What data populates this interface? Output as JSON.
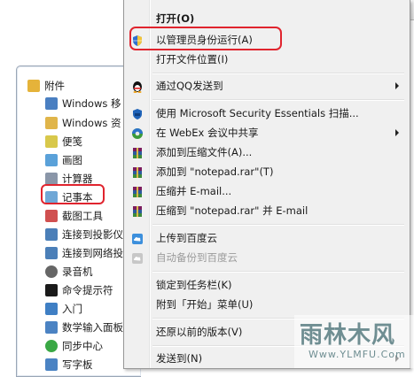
{
  "start_menu": {
    "items": [
      {
        "label": "附件",
        "icon": "folder-icon",
        "color": "#e5b33a"
      },
      {
        "label": "Windows 移",
        "icon": "windows-mobility-icon",
        "color": "#4a7fc1"
      },
      {
        "label": "Windows 资",
        "icon": "explorer-folder-icon",
        "color": "#e0b54a"
      },
      {
        "label": "便笺",
        "icon": "sticky-note-icon",
        "color": "#d8c84b"
      },
      {
        "label": "画图",
        "icon": "paint-icon",
        "color": "#5aa1d9"
      },
      {
        "label": "计算器",
        "icon": "calculator-icon",
        "color": "#8a96a8"
      },
      {
        "label": "记事本",
        "icon": "notepad-icon",
        "color": "#6fa7d6"
      },
      {
        "label": "截图工具",
        "icon": "snipping-tool-icon",
        "color": "#d05050"
      },
      {
        "label": "连接到投影仪",
        "icon": "projector-icon",
        "color": "#4b7fb8"
      },
      {
        "label": "连接到网络投",
        "icon": "network-projector-icon",
        "color": "#4b7fb8"
      },
      {
        "label": "录音机",
        "icon": "microphone-icon",
        "color": "#666666"
      },
      {
        "label": "命令提示符",
        "icon": "command-prompt-icon",
        "color": "#1a1a1a"
      },
      {
        "label": "入门",
        "icon": "getting-started-icon",
        "color": "#3f7fc4"
      },
      {
        "label": "数学输入面板",
        "icon": "math-input-icon",
        "color": "#4b83c3"
      },
      {
        "label": "同步中心",
        "icon": "sync-center-icon",
        "color": "#3aa845"
      },
      {
        "label": "写字板",
        "icon": "wordpad-icon",
        "color": "#4b83c3"
      }
    ]
  },
  "context_menu": {
    "items": [
      {
        "label": "打开(O)",
        "bold": true,
        "icon": "",
        "disabled": false,
        "submenu": false
      },
      {
        "label": "以管理员身份运行(A)",
        "icon": "uac-shield-icon",
        "disabled": false,
        "submenu": false
      },
      {
        "label": "打开文件位置(I)",
        "icon": "",
        "disabled": false,
        "submenu": false
      },
      {
        "label": "通过QQ发送到",
        "icon": "qq-penguin-icon",
        "disabled": false,
        "submenu": true
      },
      {
        "label": "使用 Microsoft Security Essentials 扫描...",
        "icon": "mse-shield-icon",
        "disabled": false,
        "submenu": false
      },
      {
        "label": "在 WebEx 会议中共享",
        "icon": "webex-icon",
        "disabled": false,
        "submenu": true
      },
      {
        "label": "添加到压缩文件(A)...",
        "icon": "winrar-icon",
        "disabled": false,
        "submenu": false
      },
      {
        "label": "添加到 \"notepad.rar\"(T)",
        "icon": "winrar-icon",
        "disabled": false,
        "submenu": false
      },
      {
        "label": "压缩并 E-mail...",
        "icon": "winrar-icon",
        "disabled": false,
        "submenu": false
      },
      {
        "label": "压缩到 \"notepad.rar\" 并 E-mail",
        "icon": "winrar-icon",
        "disabled": false,
        "submenu": false
      },
      {
        "label": "上传到百度云",
        "icon": "baidu-cloud-icon",
        "disabled": false,
        "submenu": false
      },
      {
        "label": "自动备份到百度云",
        "icon": "baidu-cloud-icon",
        "disabled": true,
        "submenu": false
      },
      {
        "label": "锁定到任务栏(K)",
        "icon": "",
        "disabled": false,
        "submenu": false
      },
      {
        "label": "附到「开始」菜单(U)",
        "icon": "",
        "disabled": false,
        "submenu": false
      },
      {
        "label": "还原以前的版本(V)",
        "icon": "",
        "disabled": false,
        "submenu": false
      },
      {
        "label": "发送到(N)",
        "icon": "",
        "disabled": false,
        "submenu": true
      }
    ]
  },
  "watermark": {
    "big": "雨林木风",
    "small": "Www.YLMFU.Com"
  },
  "highlight_color": "#e0242e"
}
